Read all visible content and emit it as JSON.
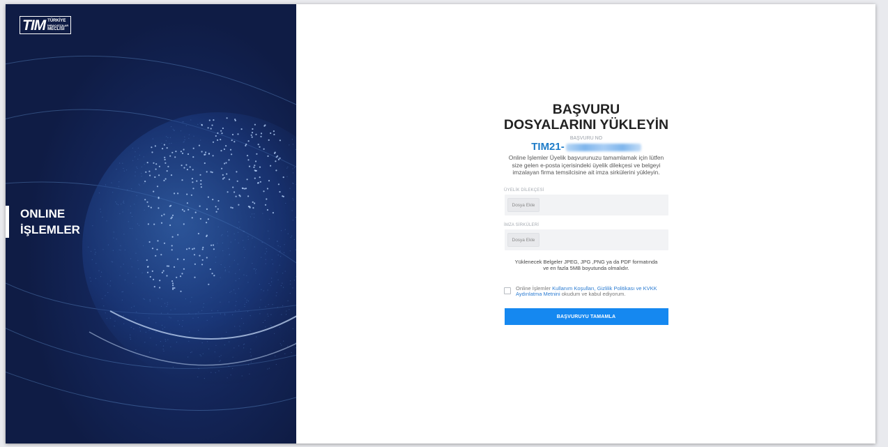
{
  "sidebar": {
    "logo": {
      "mark": "TIM",
      "line1": "TÜRKİYE",
      "line2": "İHRACATÇILAR",
      "line3": "MECLİSİ"
    },
    "title_line1": "ONLINE",
    "title_line2": "İŞLEMLER",
    "background_color": "#0f1c45"
  },
  "form": {
    "title_line1": "BAŞVURU",
    "title_line2": "DOSYALARINI YÜKLEYİN",
    "application_no_label": "BAŞVURU NO",
    "application_no_prefix": "TIM21-",
    "intro": "Online İşlemler Üyelik başvurunuzu tamamlamak için lütfen size gelen e-posta içerisindeki üyelik dilekçesi ve belgeyi imzalayan firma temsilcisine ait imza sirkülerini yükleyin.",
    "fields": [
      {
        "label": "ÜYELİK DİLEKÇESİ",
        "button": "Dosya Ekle"
      },
      {
        "label": "İMZA SİRKÜLERİ",
        "button": "Dosya Ekle"
      }
    ],
    "note_line1": "Yüklenecek Belgeler JPEG, JPG ,PNG ya da PDF formatında",
    "note_line2": "ve en fazla 5MB boyutunda olmalıdır.",
    "consent_prefix": "Online İşlemler ",
    "consent_link": "Kullanım Koşulları, Gizlilik Politikası ve KVKK Aydınlatma Metnini",
    "consent_suffix": " okudum ve kabul ediyorum.",
    "submit_label": "BAŞVURUYU TAMAMLA",
    "accent_color": "#1588f0"
  }
}
